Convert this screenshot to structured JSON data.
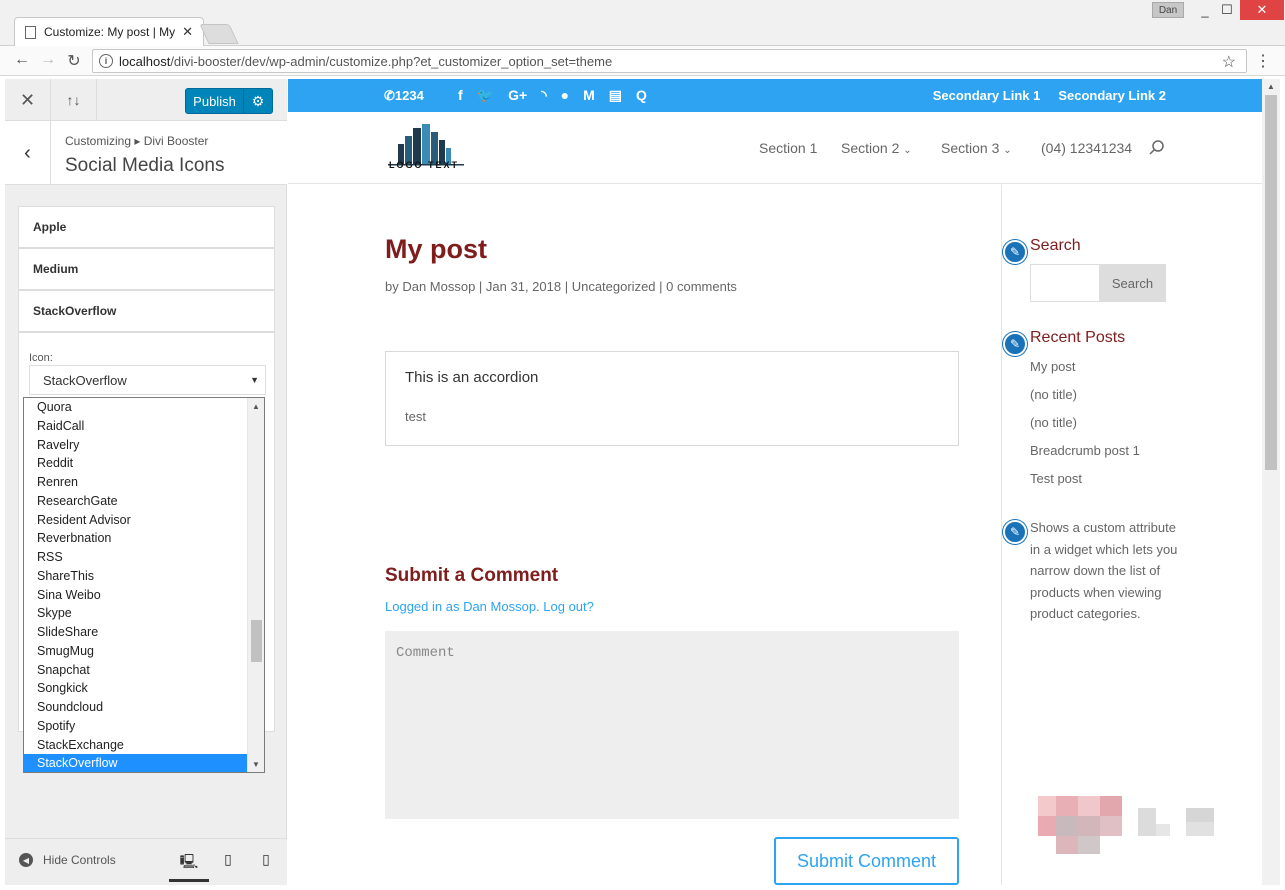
{
  "browser": {
    "tab_title": "Customize: My post | My",
    "tab_close": "✕",
    "user": "Dan",
    "url_host": "localhost",
    "url_path": "/divi-booster/dev/wp-admin/customize.php?et_customizer_option_set=theme"
  },
  "customizer": {
    "publish_label": "Publish",
    "breadcrumb": "Customizing ▸ Divi Booster",
    "section_title": "Social Media Icons",
    "accordions": [
      "Apple",
      "Medium",
      "StackOverflow"
    ],
    "icon_label": "Icon:",
    "selected_icon": "StackOverflow",
    "dropdown_options": [
      "Quora",
      "RaidCall",
      "Ravelry",
      "Reddit",
      "Renren",
      "ResearchGate",
      "Resident Advisor",
      "Reverbnation",
      "RSS",
      "ShareThis",
      "Sina Weibo",
      "Skype",
      "SlideShare",
      "SmugMug",
      "Snapchat",
      "Songkick",
      "Soundcloud",
      "Spotify",
      "StackExchange",
      "StackOverflow"
    ],
    "selected_index": 19,
    "hide_controls": "Hide Controls"
  },
  "site": {
    "phone": "1234",
    "secondary_links": [
      "Secondary Link 1",
      "Secondary Link 2"
    ],
    "logo_text": "LOGO TEXT",
    "nav": [
      "Section 1",
      "Section 2",
      "Section 3",
      "(04) 12341234"
    ],
    "post_title": "My post",
    "meta": "by Dan Mossop | Jan 31, 2018 | Uncategorized | 0 comments",
    "accordion_title": "This is an accordion",
    "accordion_body": "test",
    "comment_heading": "Submit a Comment",
    "logged_in": "Logged in as Dan Mossop. Log out?",
    "comment_placeholder": "Comment",
    "submit_label": "Submit Comment",
    "sidebar": {
      "search_title": "Search",
      "search_button": "Search",
      "recent_title": "Recent Posts",
      "recent_posts": [
        "My post",
        "(no title)",
        "(no title)",
        "Breadcrumb post 1",
        "Test post"
      ],
      "custom_text": "Shows a custom attribute in a widget which lets you narrow down the list of products when viewing product categories."
    }
  },
  "colors": {
    "accent": "#2ea3f2",
    "title": "#7f1d1d",
    "publish": "#0085ba",
    "selected_option": "#1e90ff"
  }
}
